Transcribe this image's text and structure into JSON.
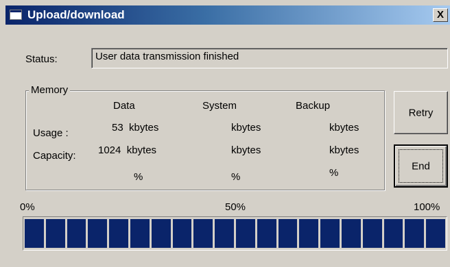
{
  "window": {
    "title": "Upload/download",
    "close_label": "X"
  },
  "status": {
    "label": "Status:",
    "value": "User data transmission finished"
  },
  "memory": {
    "legend": "Memory",
    "columns": [
      "Data",
      "System",
      "Backup"
    ],
    "rows": [
      {
        "label": "Usage :",
        "cells": [
          "53  kbytes",
          "kbytes",
          "kbytes"
        ]
      },
      {
        "label": "Capacity:",
        "cells": [
          "1024  kbytes",
          "kbytes",
          "kbytes"
        ]
      },
      {
        "label": "",
        "cells": [
          "%",
          "%",
          "%"
        ]
      }
    ]
  },
  "buttons": {
    "retry": "Retry",
    "end": "End"
  },
  "progress": {
    "labels": {
      "start": "0%",
      "mid": "50%",
      "end": "100%"
    },
    "value_percent": 100,
    "segments": 20,
    "color": "#0a246a"
  }
}
